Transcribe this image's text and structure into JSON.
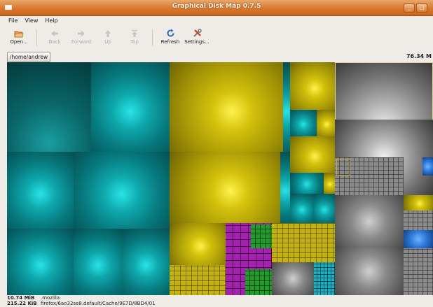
{
  "window": {
    "title": "Graphical Disk Map 0.7.5"
  },
  "menu": {
    "file": "File",
    "view": "View",
    "help": "Help"
  },
  "toolbar": {
    "open": "Open...",
    "back": "Back",
    "forward": "Forward",
    "up": "Up",
    "top": "Top",
    "refresh": "Refresh",
    "settings": "Settings..."
  },
  "path": {
    "current": "/home/andrew",
    "total": "76.34 M"
  },
  "status": {
    "line1_size": "10.74 MiB",
    "line1_name": ".mozilla",
    "line2_size": "215.22 KiB",
    "line2_name": "firefox/6ao32se8.default/Cache/9E7D/8BD4/01"
  },
  "colors": {
    "titlebar": "#d9782f",
    "teal": "#0ea8ac",
    "gold": "#d4c20c",
    "gray": "#b4b4b4",
    "purple": "#a01aa8",
    "green": "#1a9a27",
    "blue": "#2a74d6"
  }
}
